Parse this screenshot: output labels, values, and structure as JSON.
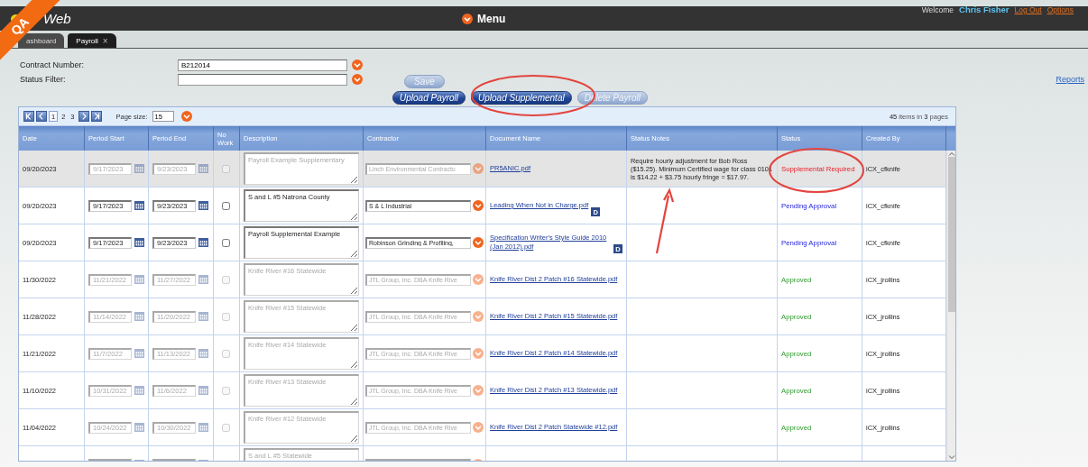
{
  "env_badge": "QA",
  "header": {
    "logo_text": "Web",
    "menu_label": "Menu",
    "welcome": "Welcome",
    "user_name": "Chris Fisher",
    "links": [
      "Log Out",
      "Options"
    ]
  },
  "tabs": [
    {
      "label": "ashboard",
      "selected": false
    },
    {
      "label": "Payroll",
      "selected": true,
      "close": "×"
    }
  ],
  "filters": [
    {
      "label": "Contract Number:",
      "value": "B212014"
    },
    {
      "label": "Status Filter:"
    }
  ],
  "save_button": {
    "label": "Save",
    "disabled": true
  },
  "actions": [
    {
      "label": "Upload Payroll",
      "disabled": false
    },
    {
      "label": "Upload Supplemental",
      "disabled": false
    },
    {
      "label": "Delete Payroll",
      "disabled": true
    }
  ],
  "reports_link": "Reports",
  "grid": {
    "pager": {
      "pages": [
        {
          "label": "1",
          "selected": true
        },
        {
          "label": "2",
          "selected": false
        },
        {
          "label": "3",
          "selected": false
        }
      ],
      "page_size_label": "Page size:",
      "page_size": "15",
      "summary": "**45** items in **3** pages"
    },
    "columns": [
      "Date",
      "Period Start",
      "Period End",
      "No Work",
      "Description",
      "Contractor",
      "Document Name",
      "Status Notes",
      "Status",
      "Created By"
    ],
    "rows": [
      {
        "date": "09/20/2023",
        "period_start": "9/17/2023",
        "period_end": "9/23/2023",
        "no_work": false,
        "description": "Payroll Example Supplementary",
        "contractor": "Linch Environmental Contracto",
        "document": "PR5ANIC.pdf",
        "notes": "Require hourly adjustment for Bob Ross ($15.25). Minimum Certified wage for class 0101 is $14.22 + $3.75 hourly fringe = $17.97.",
        "status": {
          "text": "Supplemental Required",
          "kind": "required"
        },
        "created_by": "iCX_cfknife",
        "disabled": true,
        "selected": true
      },
      {
        "date": "09/20/2023",
        "period_start": "9/17/2023",
        "period_end": "9/23/2023",
        "no_work": false,
        "description": "S and L #5 Natrona County",
        "contractor": "S & L Industrial",
        "document": "Leading When Not in Charge.pdf",
        "document_badge": "D",
        "status": {
          "text": "Pending Approval",
          "kind": "pending"
        },
        "created_by": "iCX_cfknife",
        "disabled": false,
        "selected": false
      },
      {
        "date": "09/20/2023",
        "period_start": "9/17/2023",
        "period_end": "9/23/2023",
        "no_work": false,
        "description": "Payroll Supplemental Example",
        "contractor": "Robinson Grinding & Profiling,",
        "document": "Specification Writer's Style Guide 2010 (Jan 2012).pdf",
        "document_badge": "D",
        "status": {
          "text": "Pending Approval",
          "kind": "pending"
        },
        "created_by": "iCX_cfknife",
        "disabled": false,
        "selected": false
      },
      {
        "date": "11/30/2022",
        "period_start": "11/21/2022",
        "period_end": "11/27/2022",
        "no_work": false,
        "description": "Knife River #16 Statewide",
        "contractor": "JTL Group, Inc. DBA Knife Rive",
        "document": "Knife River Dist 2 Patch #16 Statewide.pdf",
        "status": {
          "text": "Approved",
          "kind": "approved"
        },
        "created_by": "iCX_jrollins",
        "disabled": true,
        "selected": false
      },
      {
        "date": "11/28/2022",
        "period_start": "11/14/2022",
        "period_end": "11/20/2022",
        "no_work": false,
        "description": "Knife River #15 Statewide",
        "contractor": "JTL Group, Inc. DBA Knife Rive",
        "document": "Knife River Dist 2 Patch #15 Statewide.pdf",
        "status": {
          "text": "Approved",
          "kind": "approved"
        },
        "created_by": "iCX_jrollins",
        "disabled": true,
        "selected": false
      },
      {
        "date": "11/21/2022",
        "period_start": "11/7/2022",
        "period_end": "11/13/2022",
        "no_work": false,
        "description": "Knife River #14 Statewide",
        "contractor": "JTL Group, Inc. DBA Knife Rive",
        "document": "Knife River Dist 2 Patch #14 Statewide.pdf",
        "status": {
          "text": "Approved",
          "kind": "approved"
        },
        "created_by": "iCX_jrollins",
        "disabled": true,
        "selected": false
      },
      {
        "date": "11/10/2022",
        "period_start": "10/31/2022",
        "period_end": "11/6/2022",
        "no_work": false,
        "description": "Knife River #13 Statewide",
        "contractor": "JTL Group, Inc. DBA Knife Rive",
        "document": "Knife River Dist 2 Patch #13 Statewide.pdf",
        "status": {
          "text": "Approved",
          "kind": "approved"
        },
        "created_by": "iCX_jrollins",
        "disabled": true,
        "selected": false
      },
      {
        "date": "11/04/2022",
        "period_start": "10/24/2022",
        "period_end": "10/30/2022",
        "no_work": false,
        "description": "Knife River #12 Statewide",
        "contractor": "JTL Group, Inc. DBA Knife Rive",
        "document": "Knife River Dist 2 Patch Statewide #12.pdf",
        "status": {
          "text": "Approved",
          "kind": "approved"
        },
        "created_by": "iCX_jrollins",
        "disabled": true,
        "selected": false
      },
      {
        "description": "S and L #5 Statewide",
        "disabled": true,
        "selected": false
      }
    ]
  }
}
